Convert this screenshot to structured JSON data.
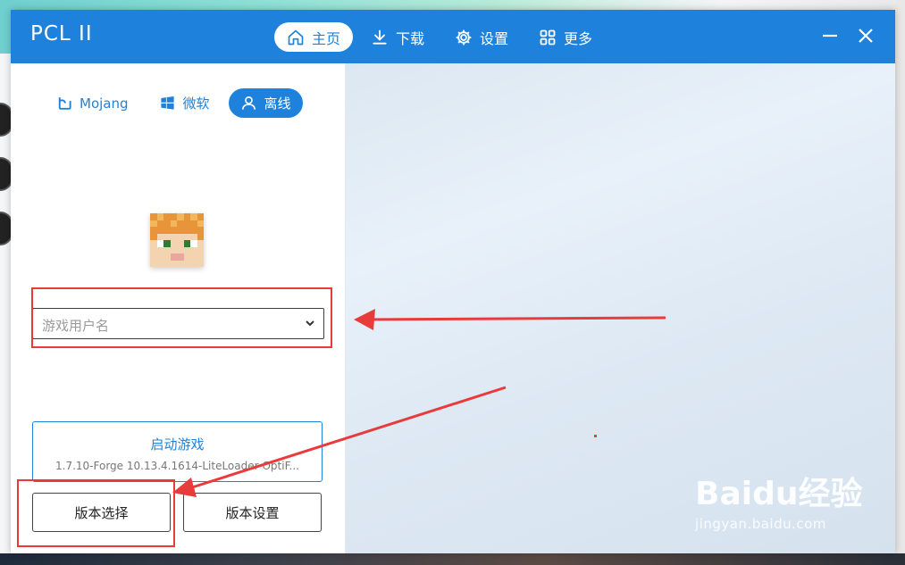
{
  "app": {
    "title": "PCL II"
  },
  "nav": [
    {
      "label": "主页",
      "icon": "home-icon",
      "active": true
    },
    {
      "label": "下载",
      "icon": "download-icon",
      "active": false
    },
    {
      "label": "设置",
      "icon": "gear-icon",
      "active": false
    },
    {
      "label": "更多",
      "icon": "grid-icon",
      "active": false
    }
  ],
  "account_tabs": [
    {
      "label": "Mojang",
      "icon": "mojang-icon",
      "active": false
    },
    {
      "label": "微软",
      "icon": "windows-icon",
      "active": false
    },
    {
      "label": "离线",
      "icon": "user-icon",
      "active": true
    }
  ],
  "login": {
    "username_placeholder": "游戏用户名"
  },
  "launch": {
    "label": "启动游戏",
    "version": "1.7.10-Forge 10.13.4.1614-LiteLoader-OptiF..."
  },
  "buttons": {
    "version_select": "版本选择",
    "version_settings": "版本设置"
  },
  "watermark": {
    "logo": "Baidu经验",
    "url": "jingyan.baidu.com"
  },
  "colors": {
    "accent": "#1e82dc",
    "annotation": "#e83b3b"
  }
}
